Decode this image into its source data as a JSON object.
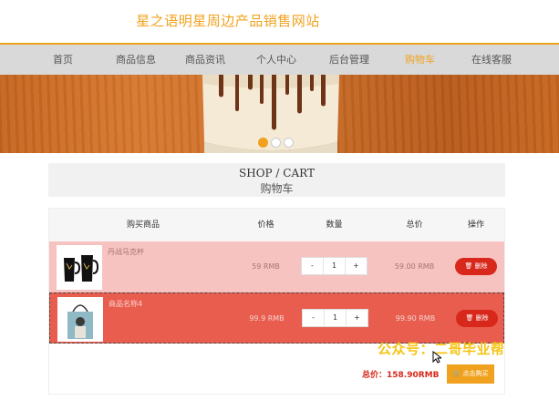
{
  "site": {
    "title": "星之语明星周边产品销售网站"
  },
  "nav": {
    "items": [
      {
        "label": "首页",
        "active": false
      },
      {
        "label": "商品信息",
        "active": false
      },
      {
        "label": "商品资讯",
        "active": false
      },
      {
        "label": "个人中心",
        "active": false
      },
      {
        "label": "后台管理",
        "active": false
      },
      {
        "label": "购物车",
        "active": true
      },
      {
        "label": "在线客服",
        "active": false
      }
    ]
  },
  "carousel": {
    "dots": 3,
    "active_index": 0
  },
  "heading": {
    "en": "SHOP / CART",
    "cn": "购物车"
  },
  "cart": {
    "columns": [
      "购买商品",
      "价格",
      "数量",
      "总价",
      "操作"
    ],
    "items": [
      {
        "name": "丹战马克杯",
        "price": "59 RMB",
        "qty": "1",
        "subtotal": "59.00 RMB",
        "delete_label": "删除",
        "minus": "-",
        "plus": "+"
      },
      {
        "name": "商品名称4",
        "price": "99.9 RMB",
        "qty": "1",
        "subtotal": "99.90 RMB",
        "delete_label": "删除",
        "minus": "-",
        "plus": "+"
      }
    ],
    "total_label": "总价：",
    "total_value": "158.90RMB",
    "checkout_label": "点击购买"
  },
  "watermark": "公众号：二哥毕业帮",
  "colors": {
    "accent": "#f0a21f",
    "danger": "#d8281b",
    "row1": "#f7c3c0",
    "row2": "#e95d4f"
  }
}
